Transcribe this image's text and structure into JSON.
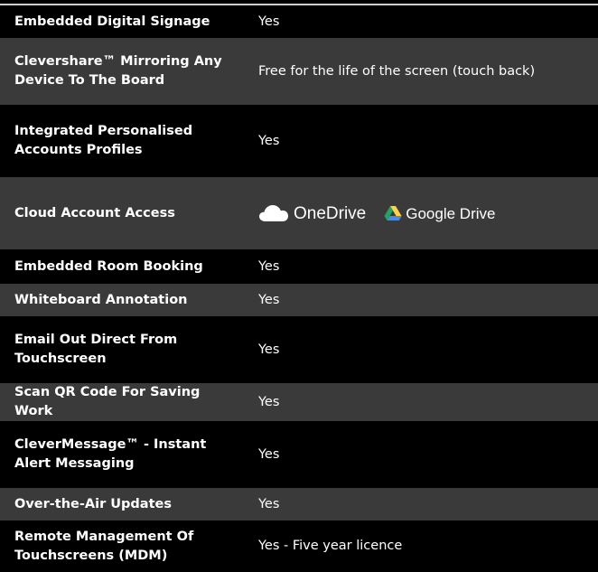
{
  "rows": [
    {
      "feature": "Embedded Digital Signage",
      "value": "Yes"
    },
    {
      "feature": "Clevershare™ Mirroring Any Device To The Board",
      "value": "Free for the life of the screen (touch back)"
    },
    {
      "feature": "Integrated Personalised Accounts Profiles",
      "value": "Yes"
    },
    {
      "feature": "Cloud Account Access",
      "logos": {
        "onedrive": "OneDrive",
        "google_drive": "Google Drive"
      }
    },
    {
      "feature": "Embedded Room Booking",
      "value": "Yes"
    },
    {
      "feature": "Whiteboard Annotation",
      "value": "Yes"
    },
    {
      "feature": "Email Out Direct From Touchscreen",
      "value": "Yes"
    },
    {
      "feature": "Scan QR Code For Saving Work",
      "value": "Yes"
    },
    {
      "feature": "CleverMessage™ - Instant Alert Messaging",
      "value": "Yes"
    },
    {
      "feature": "Over-the-Air Updates",
      "value": "Yes"
    },
    {
      "feature": "Remote Management Of Touchscreens (MDM)",
      "value": "Yes - Five year licence"
    }
  ],
  "colors": {
    "row_dark": "#000000",
    "row_light": "#3a3a3a",
    "text": "#ffffff",
    "gdrive_green": "#1fa463",
    "gdrive_yellow": "#ffd04b",
    "gdrive_blue": "#4688f4"
  },
  "icons": [
    "onedrive-cloud-icon",
    "google-drive-icon"
  ]
}
